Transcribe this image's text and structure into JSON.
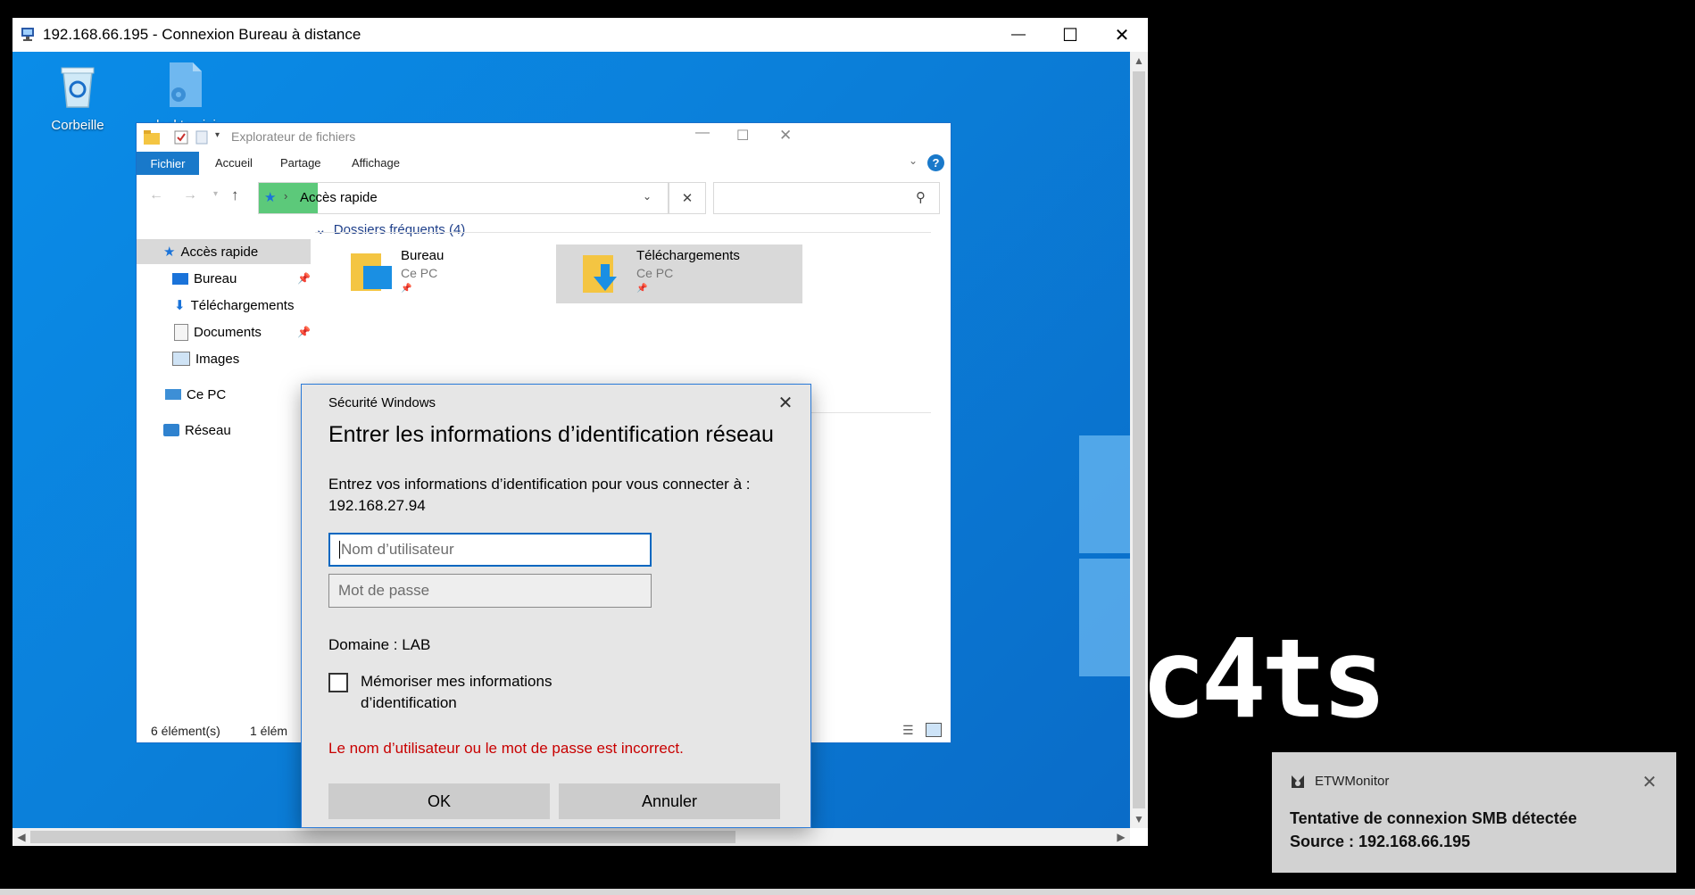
{
  "rdp": {
    "title": "192.168.66.195 - Connexion Bureau à distance",
    "minimize": "—",
    "maximize": "☐",
    "close": "✕"
  },
  "desktop": {
    "icons": [
      {
        "label": "Corbeille",
        "icon": "recycle-bin-icon"
      },
      {
        "label": "desktop.ini",
        "icon": "settings-file-icon"
      }
    ]
  },
  "explorer": {
    "title": "Explorateur de fichiers",
    "tabs": [
      "Fichier",
      "Accueil",
      "Partage",
      "Affichage"
    ],
    "address": "Accès rapide",
    "nav": {
      "quick_access": "Accès rapide",
      "pinned": [
        "Bureau",
        "Téléchargements",
        "Documents",
        "Images"
      ],
      "this_pc": "Ce PC",
      "network": "Réseau"
    },
    "section_header": "Dossiers fréquents (4)",
    "folders": [
      {
        "name": "Bureau",
        "location": "Ce PC"
      },
      {
        "name": "Téléchargements",
        "location": "Ce PC"
      }
    ],
    "status": {
      "count": "6 élément(s)",
      "selected": "1 élém"
    }
  },
  "dialog": {
    "caption": "Sécurité Windows",
    "heading": "Entrer les informations d’identification réseau",
    "prompt": "Entrez vos informations d’identification pour vous connecter à :",
    "host": "192.168.27.94",
    "username_placeholder": "Nom d’utilisateur",
    "password_placeholder": "Mot de passe",
    "domain": "Domaine : LAB",
    "remember_line1": "Mémoriser mes informations",
    "remember_line2": "d’identification",
    "error": "Le nom d’utilisateur ou le mot de passe est incorrect.",
    "ok": "OK",
    "cancel": "Annuler"
  },
  "toast": {
    "app": "ETWMonitor",
    "line1": "Tentative de connexion SMB détectée",
    "line2": "Source : 192.168.66.195"
  },
  "brand_text": "c4ts",
  "colors": {
    "desktop_blue": "#0b7fd9",
    "accent": "#1979ca",
    "error": "#c80000",
    "toast_bg": "#d2d2d2"
  }
}
